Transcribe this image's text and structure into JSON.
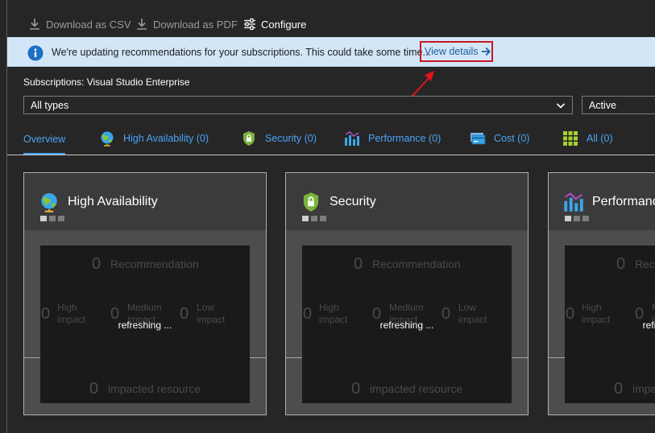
{
  "toolbar": {
    "download_csv": "Download as CSV",
    "download_pdf": "Download as PDF",
    "configure": "Configure"
  },
  "banner": {
    "message": "We're updating recommendations for your subscriptions. This could take some time...",
    "link": "View details"
  },
  "subscriptions": {
    "label": "Subscriptions: Visual Studio Enterprise"
  },
  "filters": {
    "type": "All types",
    "status": "Active"
  },
  "tabs": [
    {
      "label": "Overview",
      "icon": "none"
    },
    {
      "label": "High Availability (0)",
      "icon": "globe-icon"
    },
    {
      "label": "Security (0)",
      "icon": "shield-lock-icon"
    },
    {
      "label": "Performance (0)",
      "icon": "bar-chart-icon"
    },
    {
      "label": "Cost (0)",
      "icon": "credit-card-icon"
    },
    {
      "label": "All (0)",
      "icon": "grid-icon"
    }
  ],
  "cards": [
    {
      "title": "High Availability",
      "icon": "globe-icon"
    },
    {
      "title": "Security",
      "icon": "shield-lock-icon"
    },
    {
      "title": "Performance",
      "icon": "bar-chart-icon"
    }
  ],
  "card_stats": {
    "recommendation_count": "0",
    "recommendation_label": "Recommendation",
    "high_count": "0",
    "high_label": "High impact",
    "medium_count": "0",
    "medium_label": "Medium impact",
    "low_count": "0",
    "low_label": "Low impact",
    "resource_count": "0",
    "resource_label": "impacted resource",
    "refreshing": "refreshing ..."
  },
  "colors": {
    "background": "#262626",
    "banner": "#d3e6f8",
    "link": "#4aa3f5",
    "highlight": "#c8161f"
  }
}
